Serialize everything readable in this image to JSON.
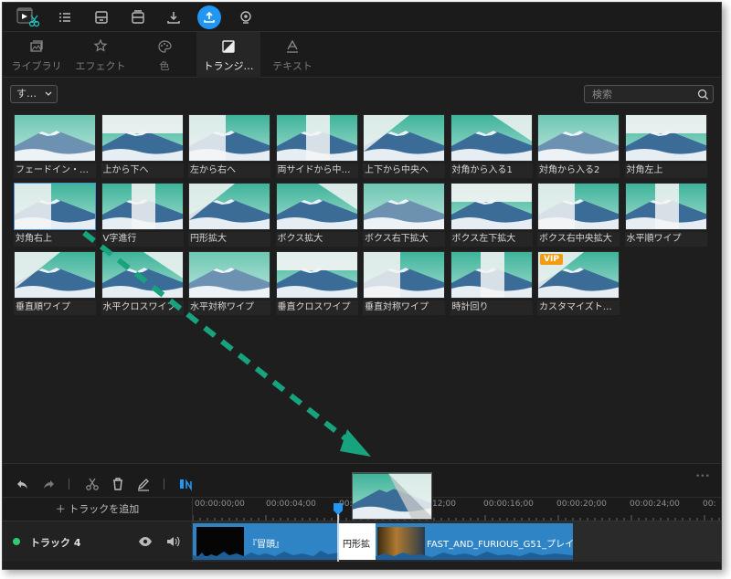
{
  "toolbar": {
    "icons": [
      "app-logo-icon",
      "list-icon",
      "save-icon",
      "save-as-icon",
      "download-icon",
      "export-icon",
      "record-icon"
    ],
    "active_icon": "export-icon"
  },
  "tabs": [
    {
      "label": "ライブラリ",
      "icon": "library-icon",
      "active": false
    },
    {
      "label": "エフェクト",
      "icon": "effects-icon",
      "active": false
    },
    {
      "label": "色",
      "icon": "palette-icon",
      "active": false
    },
    {
      "label": "トランジ…",
      "icon": "transition-icon",
      "active": true
    },
    {
      "label": "テキスト",
      "icon": "text-icon",
      "active": false
    }
  ],
  "filter": {
    "dropdown_value": "す…",
    "search_placeholder": "検索"
  },
  "transitions": [
    {
      "label": "フェードイン・…"
    },
    {
      "label": "上から下へ"
    },
    {
      "label": "左から右へ"
    },
    {
      "label": "両サイドから中…"
    },
    {
      "label": "上下から中央へ"
    },
    {
      "label": "対角から入る1"
    },
    {
      "label": "対角から入る2"
    },
    {
      "label": "対角左上"
    },
    {
      "label": "対角右上",
      "selected": true
    },
    {
      "label": "V字進行"
    },
    {
      "label": "円形拡大"
    },
    {
      "label": "ボクス拡大"
    },
    {
      "label": "ボクス右下拡大"
    },
    {
      "label": "ボクス左下拡大"
    },
    {
      "label": "ボクス右中央拡大"
    },
    {
      "label": "水平順ワイプ"
    },
    {
      "label": "垂直順ワイプ"
    },
    {
      "label": "水平クロスワイプ"
    },
    {
      "label": "水平対称ワイプ"
    },
    {
      "label": "垂直クロスワイプ"
    },
    {
      "label": "垂直対称ワイプ"
    },
    {
      "label": "時計回り"
    },
    {
      "label": "カスタマイズト…",
      "vip": "VIP"
    }
  ],
  "timeline": {
    "add_track": "＋ トラックを追加",
    "ruler": [
      "00:00:00;00",
      "00:00:04;00",
      "00:0",
      "12;00",
      "00:00:16;00",
      "00:00:20;00",
      "00:00:24;00",
      "00:"
    ],
    "track_name": "トラック 4",
    "clips": {
      "clip1": "『冒頭』",
      "transition": "円形拡",
      "clip3": "FAST_AND_FURIOUS_G51_プレイ"
    }
  },
  "colors": {
    "accent": "#2196f3",
    "arrow": "#1aa37a",
    "clip": "#2f84c5"
  }
}
